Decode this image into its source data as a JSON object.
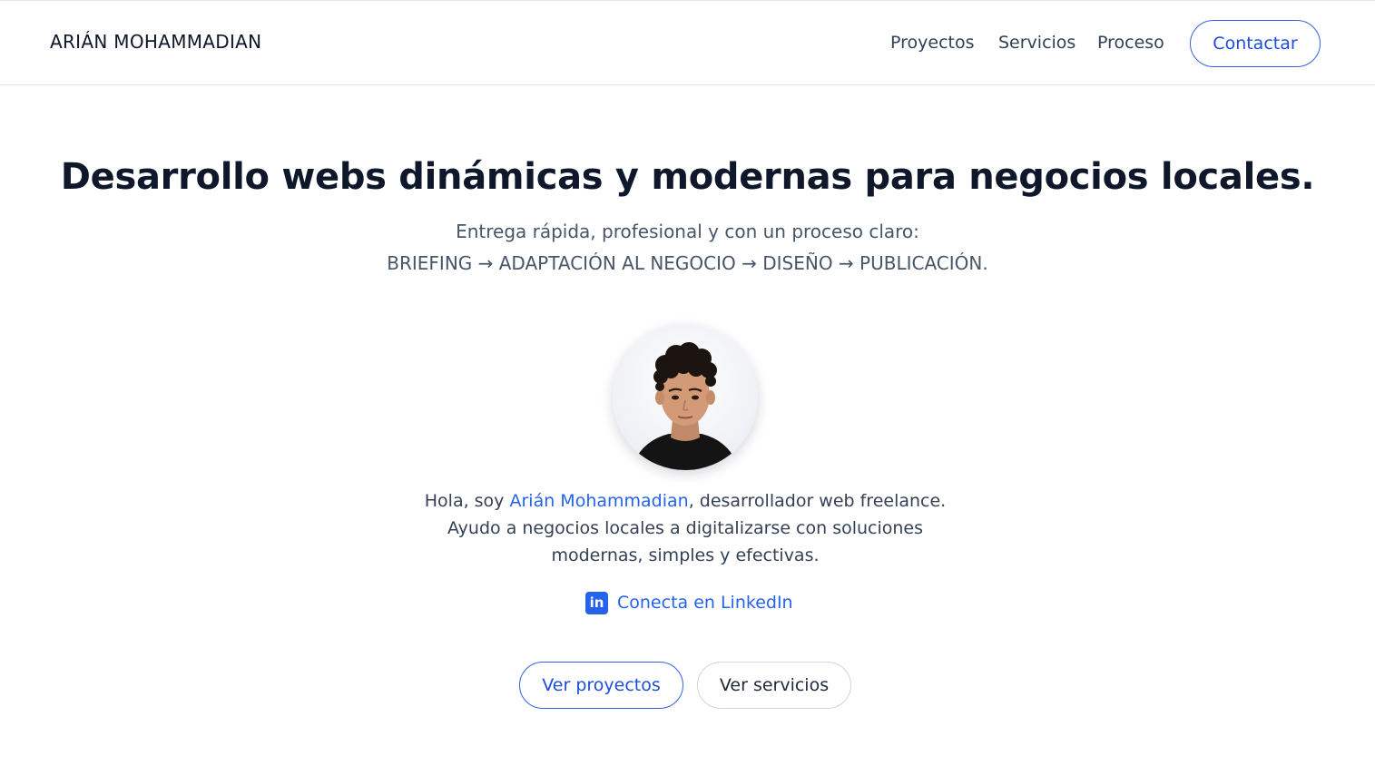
{
  "header": {
    "brand": "ARIÁN MOHAMMADIAN",
    "nav": {
      "projects": "Proyectos",
      "services": "Servicios",
      "process": "Proceso"
    },
    "contact_label": "Contactar"
  },
  "hero": {
    "title": "Desarrollo webs dinámicas y modernas para negocios locales.",
    "subtitle_line1": "Entrega rápida, profesional y con un proceso claro:",
    "subtitle_line2": "BRIEFING → ADAPTACIÓN AL NEGOCIO → DISEÑO → PUBLICACIÓN."
  },
  "bio": {
    "prefix": "Hola, soy ",
    "name": "Arián Mohammadian",
    "suffix": ", desarrollador web freelance.",
    "line2": "Ayudo a negocios locales a digitalizarse con soluciones",
    "line3": "modernas, simples y efectivas."
  },
  "linkedin": {
    "icon": "linkedin-icon",
    "icon_glyph": "in",
    "label": "Conecta en LinkedIn"
  },
  "actions": {
    "projects_label": "Ver proyectos",
    "services_label": "Ver servicios"
  },
  "colors": {
    "accent": "#2563eb",
    "text": "#0f172a",
    "muted": "#475569"
  }
}
